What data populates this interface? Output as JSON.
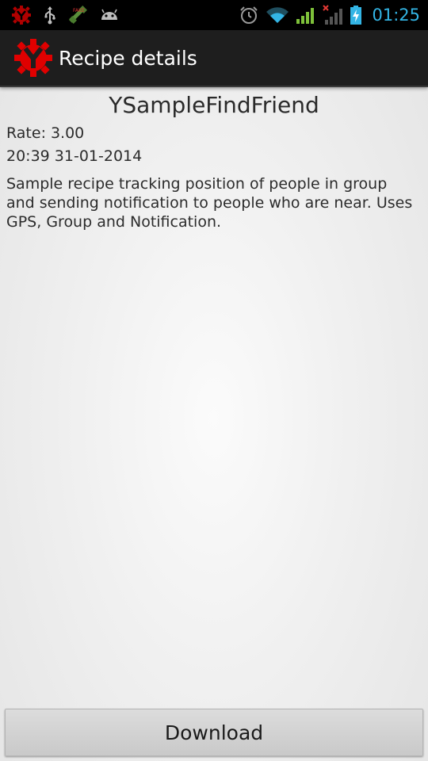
{
  "status_bar": {
    "time": "01:25",
    "left_icons": [
      "app-gear-icon",
      "usb-icon",
      "gps-icon",
      "android-debug-icon"
    ],
    "right_icons": [
      "alarm-icon",
      "wifi-icon",
      "signal-icon",
      "no-signal-icon",
      "battery-charging-icon"
    ],
    "accent_color": "#33b5e5"
  },
  "action_bar": {
    "title": "Recipe details",
    "logo_icon": "app-logo-icon",
    "logo_color": "#e00000"
  },
  "recipe": {
    "name": "YSampleFindFriend",
    "rate_label": "Rate:",
    "rate_value": "3.00",
    "timestamp": "20:39 31-01-2014",
    "description": "Sample recipe tracking position of people in group and sending notification to people who are near. Uses GPS, Group and Notification."
  },
  "actions": {
    "download_label": "Download"
  }
}
